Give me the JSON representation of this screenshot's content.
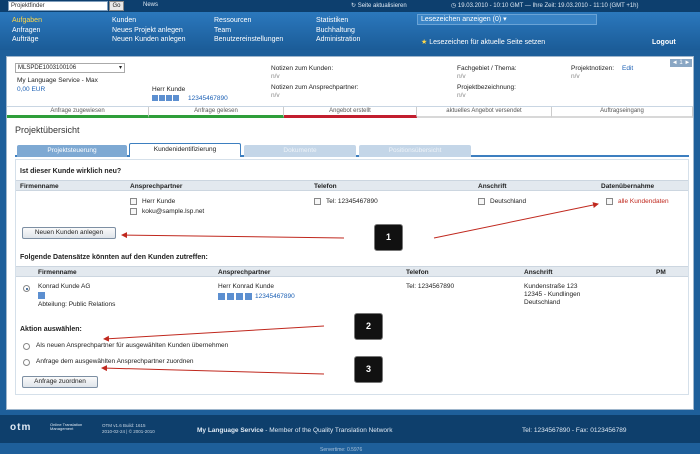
{
  "topbar": {
    "finder_value": "Projektfinder",
    "go_label": "Go",
    "news_label": "News",
    "refresh_label": "Seite aktualisieren",
    "clock_text": "19.03.2010 - 10:10 GMT  —  Ihre Zeit: 19.03.2010 - 11:10 (GMT +1h)"
  },
  "nav": {
    "col1": [
      "Aufgaben",
      "Anfragen",
      "Aufträge"
    ],
    "col2": [
      "Kunden",
      "Neues Projekt anlegen",
      "Neuen Kunden anlegen"
    ],
    "col3": [
      "Ressourcen",
      "Team",
      "Benutzereinstellungen"
    ],
    "col4": [
      "Statistiken",
      "Buchhaltung",
      "Administration"
    ],
    "bookmarks_show": "Lesezeichen anzeigen (0)",
    "bookmarks_set": "Lesezeichen für aktuelle Seite setzen",
    "logout": "Logout"
  },
  "info": {
    "project_select": "MLSPDE1003100106",
    "company": "My Language Service - Max",
    "amount": "0,00 EUR",
    "contact_name": "Herr Kunde",
    "contact_phone": "12345467890",
    "notes_customer_label": "Notizen zum Kunden:",
    "notes_customer_value": "n/v",
    "notes_contact_label": "Notizen zum Ansprechpartner:",
    "notes_contact_value": "n/v",
    "field_label": "Fachgebiet / Thema:",
    "field_value": "n/v",
    "project_desc_label": "Projektbezeichnung:",
    "project_desc_value": "n/v",
    "project_notes_label": "Projektnotizen:",
    "project_notes_edit": "Edit",
    "project_notes_value": "n/v",
    "pager": "◄ 1 ►"
  },
  "status_steps": [
    "Anfrage zugewiesen",
    "Anfrage gelesen",
    "Angebot erstellt",
    "aktuelles Angebot versendet",
    "Auftragseingang"
  ],
  "page_title": "Projektübersicht",
  "tabs": [
    "Projektsteuerung",
    "Kundenidentifizierung",
    "Dokumente",
    "Positionsübersicht"
  ],
  "section1": {
    "question": "Ist dieser Kunde wirklich neu?",
    "headers": [
      "Firmenname",
      "Ansprechpartner",
      "Telefon",
      "Anschrift",
      "Datenübernahme"
    ],
    "contact": "Herr Kunde",
    "email": "koku@sample.lsp.net",
    "phone": "Tel: 12345467890",
    "address": "Deutschland",
    "take_all": "alle Kundendaten",
    "new_button": "Neuen Kunden anlegen"
  },
  "section2": {
    "question": "Folgende Datensätze könnten auf den Kunden zutreffen:",
    "headers": [
      "Firmenname",
      "Ansprechpartner",
      "Telefon",
      "Anschrift",
      "PM"
    ],
    "company": "Konrad Kunde AG",
    "department": "Abteilung: Public Relations",
    "contact": "Herr Konrad Kunde",
    "contact_phone": "12345467890",
    "phone": "Tel: 1234567890",
    "street": "Kundenstraße 123",
    "city": "12345 - Kundlingen",
    "country": "Deutschland"
  },
  "section3": {
    "title": "Aktion auswählen:",
    "option1": "Als neuen Ansprechpartner für ausgewählten Kunden übernehmen",
    "option2": "Anfrage dem ausgewählten Ansprechpartner zuordnen",
    "assign_button": "Anfrage zuordnen"
  },
  "callouts": [
    "1",
    "2",
    "3"
  ],
  "colors": {
    "accent": "#1b5c98",
    "arrow": "#c0281e"
  },
  "footer": {
    "logo": "otm",
    "logo_tag": "Online Translation Management",
    "version": "OTM v1.6 Build: 1615",
    "copyright": "2010-02-24 | © 2001-2010",
    "company": "My Language Service",
    "tagline": " - Member of the Quality Translation Network",
    "contact": "Tel: 1234567890 - Fax: 0123456789",
    "servertime": "Servertime: 0.5976"
  }
}
